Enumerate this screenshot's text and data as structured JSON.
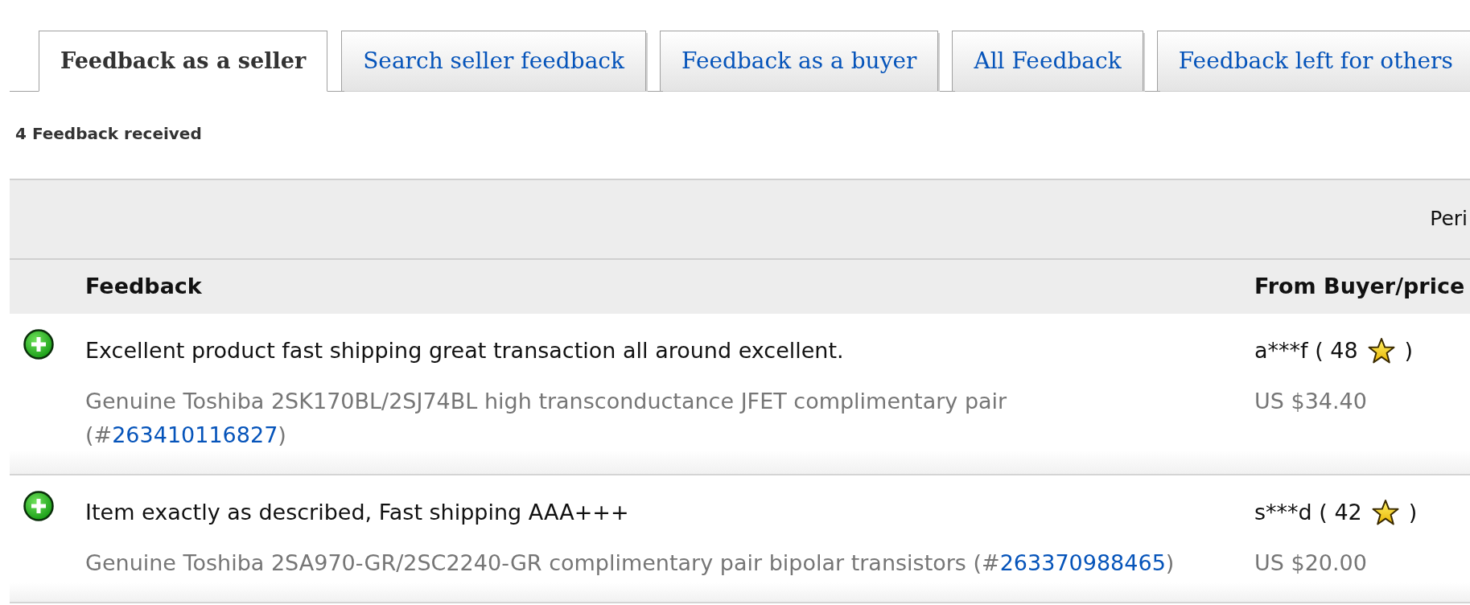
{
  "tabs": [
    {
      "label": "Feedback as a seller",
      "selected": true
    },
    {
      "label": "Search seller feedback",
      "selected": false
    },
    {
      "label": "Feedback as a buyer",
      "selected": false
    },
    {
      "label": "All Feedback",
      "selected": false
    },
    {
      "label": "Feedback left for others",
      "selected": false
    }
  ],
  "summary": "4 Feedback received",
  "filter_bar": {
    "label": "Peri"
  },
  "table": {
    "columns": [
      "Feedback",
      "From Buyer/price"
    ],
    "rows": [
      {
        "kind": "positive",
        "comment": "Excellent product fast shipping great transaction all around excellent.",
        "item_title": "Genuine Toshiba 2SK170BL/2SJ74BL high transconductance JFET complimentary pair",
        "item_number_open": "(#",
        "item_number": "263410116827",
        "item_number_close": ")",
        "buyer": "a***f ( 48",
        "buyer_close": ")",
        "price": "US $34.40"
      },
      {
        "kind": "positive",
        "comment": "Item exactly as described, Fast shipping AAA+++",
        "item_title": "Genuine Toshiba 2SA970-GR/2SC2240-GR complimentary pair bipolar transistors",
        "item_number_open": "(#",
        "item_number": "263370988465",
        "item_number_close": ")",
        "buyer": "s***d ( 42",
        "buyer_close": ")",
        "price": "US $20.00"
      }
    ]
  }
}
